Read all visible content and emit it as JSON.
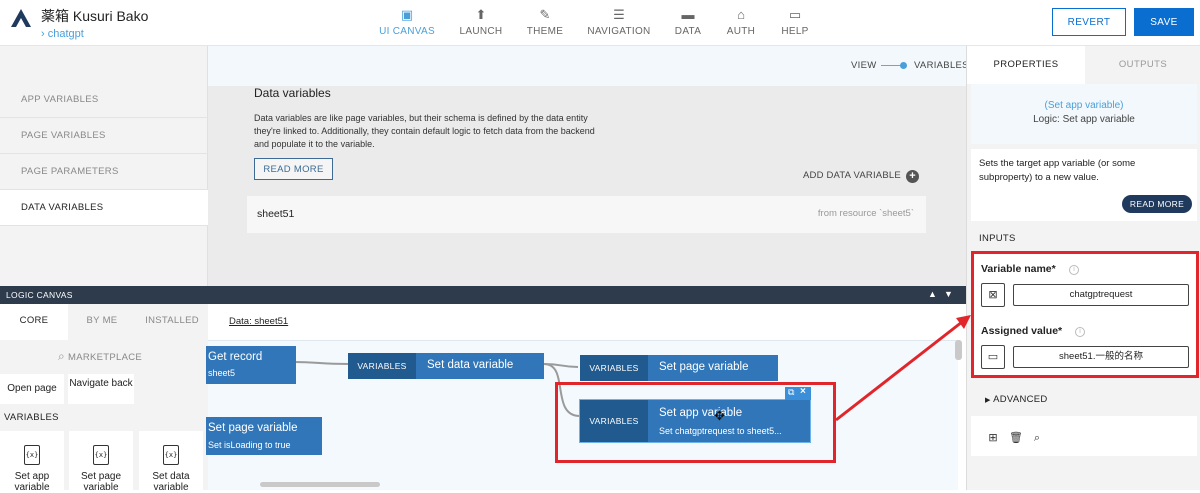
{
  "app": {
    "name": "薬箱 Kusuri Bako",
    "breadcrumb": "chatgpt"
  },
  "nav": [
    {
      "label": "UI CANVAS",
      "icon": "▣",
      "active": true
    },
    {
      "label": "LAUNCH",
      "icon": "⬆"
    },
    {
      "label": "THEME",
      "icon": "✎"
    },
    {
      "label": "NAVIGATION",
      "icon": "☰"
    },
    {
      "label": "DATA",
      "icon": "▬"
    },
    {
      "label": "AUTH",
      "icon": "⌂"
    },
    {
      "label": "HELP",
      "icon": "▭"
    }
  ],
  "actions": {
    "revert": "REVERT",
    "save": "SAVE"
  },
  "variables_menu": [
    "APP VARIABLES",
    "PAGE VARIABLES",
    "PAGE PARAMETERS",
    "DATA VARIABLES"
  ],
  "view_toggle": {
    "view": "VIEW",
    "variables": "VARIABLES"
  },
  "data_vars": {
    "title": "Data variables",
    "description": "Data variables are like page variables, but their schema is defined by the data entity they're linked to. Additionally, they contain default logic to fetch data from the backend and populate it to the variable.",
    "read_more": "READ MORE",
    "add": "ADD DATA VARIABLE",
    "items": [
      {
        "name": "sheet51",
        "source": "from resource `sheet5`"
      }
    ]
  },
  "logic": {
    "bar_label": "LOGIC CANVAS",
    "tabs": [
      "CORE",
      "BY ME",
      "INSTALLED"
    ],
    "marketplace": "MARKETPLACE",
    "tiles": [
      "Open page",
      "Navigate back"
    ],
    "section": "VARIABLES",
    "var_tiles": [
      "Set app variable",
      "Set page variable",
      "Set data variable"
    ],
    "data_header": "Data: sheet51",
    "nodes": {
      "get_record": {
        "title": "Get record",
        "subtitle": "sheet5"
      },
      "set_data_var": {
        "tag": "VARIABLES",
        "title": "Set data variable"
      },
      "set_page_var1": {
        "tag": "VARIABLES",
        "title": "Set page variable"
      },
      "set_page_var2": {
        "title": "Set page variable",
        "subtitle": "Set isLoading to true"
      },
      "set_app_var": {
        "tag": "VARIABLES",
        "title": "Set app variable",
        "subtitle": "Set chatgptrequest to sheet5..."
      }
    }
  },
  "right_panel": {
    "tabs": [
      "PROPERTIES",
      "OUTPUTS"
    ],
    "node_title": "(Set app variable)",
    "node_logic": "Logic: Set app variable",
    "description": "Sets the target app variable (or some subproperty) to a new value.",
    "read_more": "READ MORE",
    "inputs_label": "INPUTS",
    "fields": [
      {
        "label": "Variable name*",
        "value": "chatgptrequest",
        "icon": "x-box-icon"
      },
      {
        "label": "Assigned value*",
        "value": "sheet51.一般的名称",
        "icon": "folder-icon"
      }
    ],
    "advanced": "ADVANCED"
  },
  "colors": {
    "accent": "#0a6ed1",
    "node": "#3076b8",
    "node_tag": "#205a8f",
    "highlight": "#e0262b"
  }
}
